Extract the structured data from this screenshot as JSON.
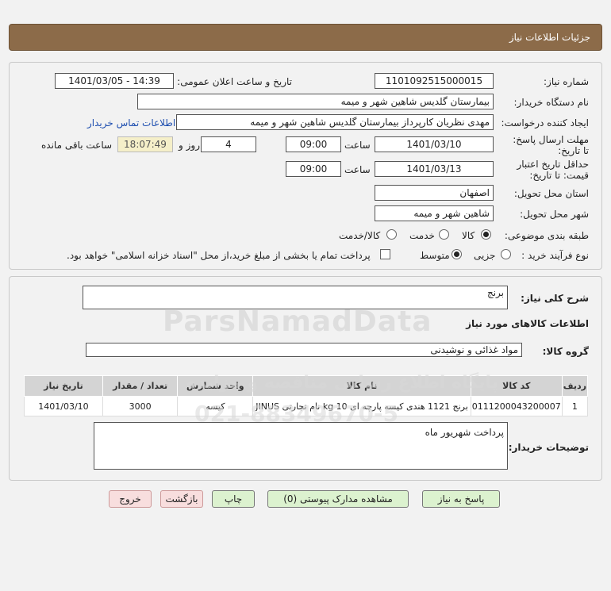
{
  "header": {
    "title": "جزئیات اطلاعات نیاز"
  },
  "watermark": {
    "brand": "ParsNamadData",
    "tagline": "پایگاه اطلاع رسانی مناقصه و مزایده",
    "phone": "021-88349670-5"
  },
  "form": {
    "need_number_label": "شماره نیاز:",
    "need_number": "1101092515000015",
    "announce_label": "تاریخ و ساعت اعلان عمومی:",
    "announce_value": "1401/03/05 - 14:39",
    "buyer_label": "نام دستگاه خریدار:",
    "buyer_value": "بیمارستان گلدیس  شاهین شهر و میمه",
    "creator_label": "ایجاد کننده درخواست:",
    "creator_value": "مهدی نظریان کارپرداز بیمارستان گلدیس  شاهین شهر و میمه",
    "contact_link": "اطلاعات تماس خریدار",
    "deadline_label": "مهلت ارسال پاسخ: تا تاریخ:",
    "deadline_date": "1401/03/10",
    "time_label": "ساعت",
    "deadline_time": "09:00",
    "days_value": "4",
    "days_label": "روز و",
    "remaining_time": "18:07:49",
    "remaining_label": "ساعت باقی مانده",
    "validity_label": "حداقل تاریخ اعتبار قیمت: تا تاریخ:",
    "validity_date": "1401/03/13",
    "validity_time": "09:00",
    "province_label": "استان محل تحویل:",
    "province_value": "اصفهان",
    "city_label": "شهر محل تحویل:",
    "city_value": "شاهین شهر و میمه",
    "category_label": "طبقه بندی موضوعی:",
    "category_options": [
      "کالا",
      "خدمت",
      "کالا/خدمت"
    ],
    "category_selected": "کالا",
    "process_label": "نوع فرآیند خرید :",
    "process_options": [
      "جزیی",
      "متوسط"
    ],
    "process_selected": "متوسط",
    "payment_note": "پرداخت تمام یا بخشی از مبلغ خرید،از محل \"اسناد خزانه اسلامی\" خواهد بود."
  },
  "details": {
    "summary_label": "شرح کلی نیاز:",
    "summary_value": "برنج",
    "goods_info_label": "اطلاعات کالاهای مورد نیاز",
    "group_label": "گروه کالا:",
    "group_value": "مواد غذائی و نوشیدنی",
    "table": {
      "headers": [
        "ردیف",
        "کد کالا",
        "نام کالا",
        "واحد شمارش",
        "تعداد / مقدار",
        "تاریخ نیاز"
      ],
      "rows": [
        [
          "1",
          "0111200043200007",
          "برنج 1121 هندی کیسه پارچه ای 10 kg نام تجارتی JINUS",
          "کیسه",
          "3000",
          "1401/03/10"
        ]
      ]
    },
    "buyer_notes_label": "توضیحات خریدار:",
    "buyer_notes_value": "پرداخت شهریور ماه"
  },
  "buttons": {
    "reply": "پاسخ به نیاز",
    "attachments": "مشاهده مدارک پیوستی (0)",
    "print": "چاپ",
    "back": "بازگشت",
    "exit": "خروج"
  }
}
